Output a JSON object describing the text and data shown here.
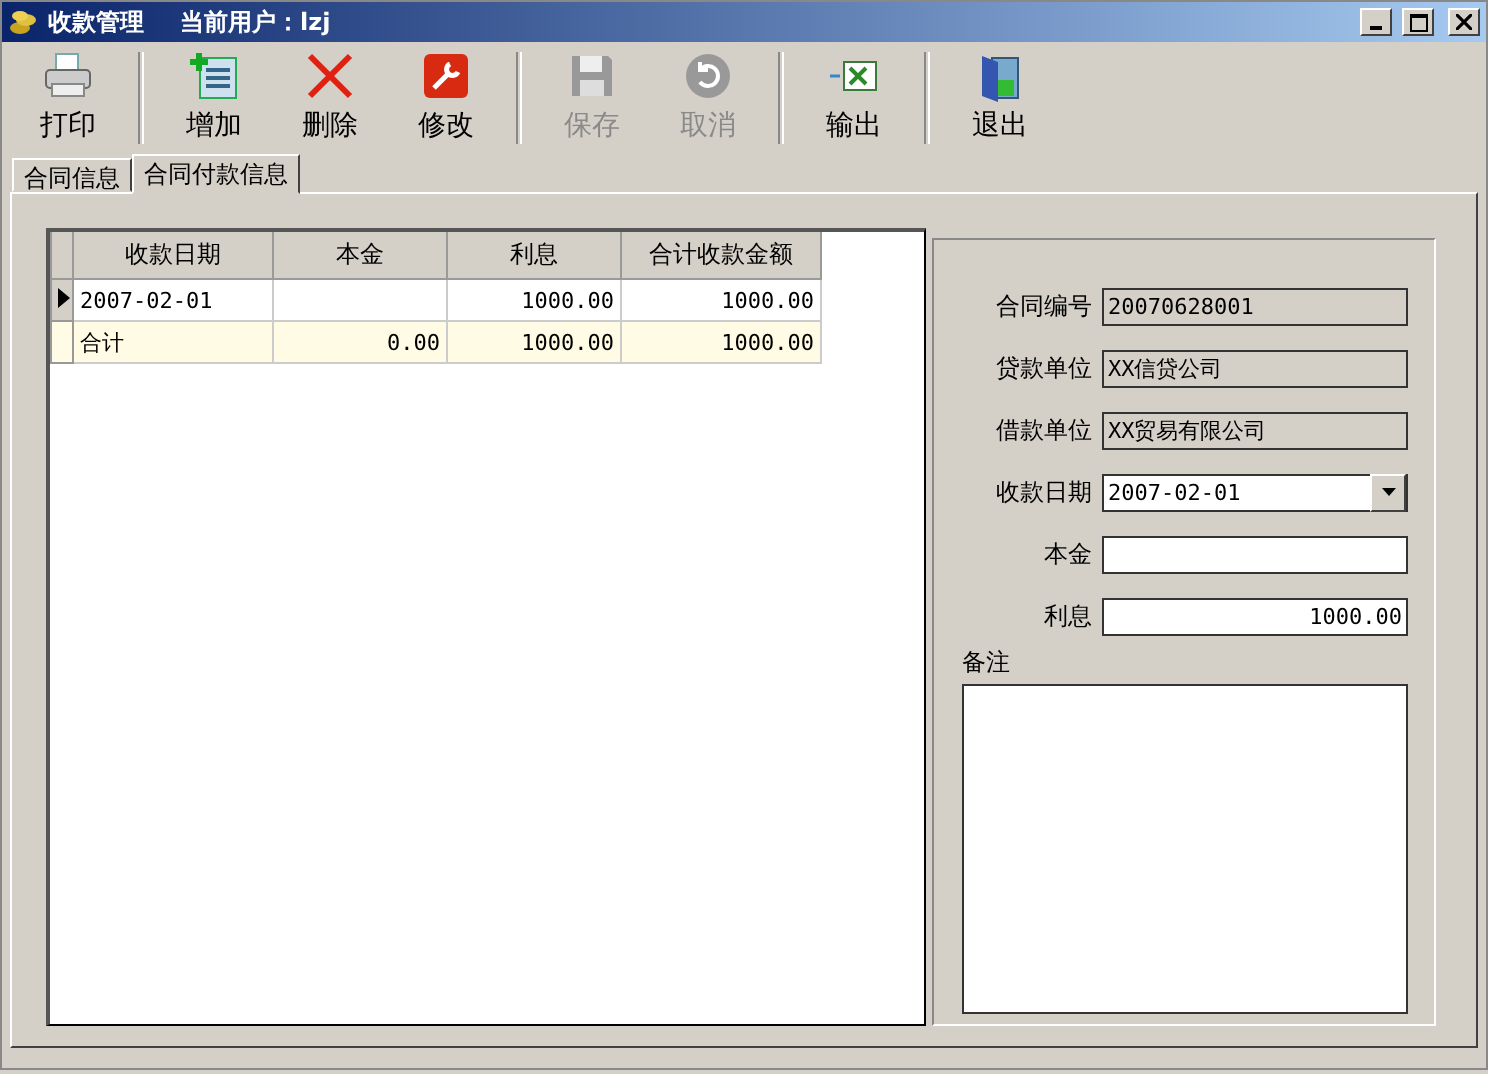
{
  "window": {
    "title": "收款管理",
    "user": "当前用户：lzj"
  },
  "toolbar_groups": [
    [
      {
        "label": "打印",
        "kind": "print",
        "disabled": false
      }
    ],
    [
      {
        "label": "增加",
        "kind": "add",
        "disabled": false
      },
      {
        "label": "删除",
        "kind": "delete",
        "disabled": false
      },
      {
        "label": "修改",
        "kind": "edit",
        "disabled": false
      }
    ],
    [
      {
        "label": "保存",
        "kind": "save",
        "disabled": true
      },
      {
        "label": "取消",
        "kind": "cancel",
        "disabled": true
      }
    ],
    [
      {
        "label": "输出",
        "kind": "export",
        "disabled": false
      }
    ],
    [
      {
        "label": "退出",
        "kind": "exit",
        "disabled": false
      }
    ]
  ],
  "tabs": [
    {
      "label": "合同信息",
      "selected": false
    },
    {
      "label": "合同付款信息",
      "selected": true
    }
  ],
  "table": {
    "columns": [
      "收款日期",
      "本金",
      "利息",
      "合计收款金额"
    ],
    "rows": [
      {
        "kind": "data",
        "selected": true,
        "cells": [
          "2007-02-01",
          "",
          "1000.00",
          "1000.00"
        ]
      },
      {
        "kind": "total",
        "selected": false,
        "cells": [
          "合计",
          "0.00",
          "1000.00",
          "1000.00"
        ]
      }
    ]
  },
  "form": [
    {
      "label": "合同编号",
      "value": "20070628001",
      "kind": "readonly"
    },
    {
      "label": "贷款单位",
      "value": "XX信贷公司",
      "kind": "readonly"
    },
    {
      "label": "借款单位",
      "value": "XX贸易有限公司",
      "kind": "readonly"
    },
    {
      "label": "收款日期",
      "value": "2007-02-01",
      "kind": "dropdown"
    },
    {
      "label": "本金",
      "kind": "number"
    },
    {
      "label": "利息",
      "value": "1000.00",
      "kind": "number"
    },
    {
      "label": "备注",
      "kind": "memo"
    }
  ]
}
